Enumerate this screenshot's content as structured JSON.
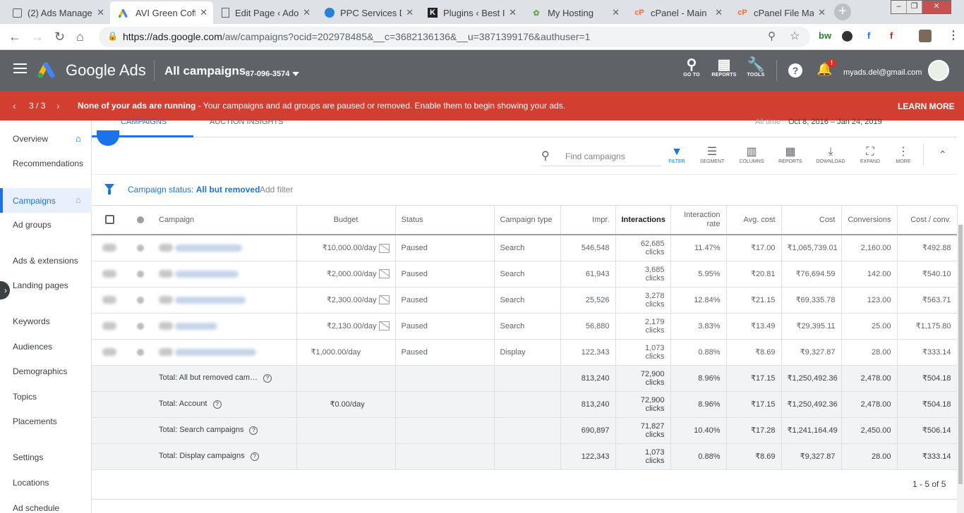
{
  "browser": {
    "tabs": [
      {
        "title": "(2) Ads Manage",
        "favicon": "fb-ads"
      },
      {
        "title": "AVI Green Coffe",
        "favicon": "google-ads"
      },
      {
        "title": "Edit Page ‹ Ado",
        "favicon": "page"
      },
      {
        "title": "PPC Services Dr",
        "favicon": "ppc"
      },
      {
        "title": "Plugins ‹ Best In",
        "favicon": "k"
      },
      {
        "title": "My Hosting",
        "favicon": "hosting"
      },
      {
        "title": "cPanel - Main",
        "favicon": "cpanel"
      },
      {
        "title": "cPanel File Mar",
        "favicon": "cpanel"
      }
    ],
    "url_host": "https://ads.google.com",
    "url_path": "/aw/campaigns?ocid=202978485&__c=3682136136&__u=3871399176&authuser=1",
    "extensions": [
      "bw",
      "f",
      "f"
    ]
  },
  "header": {
    "product_google": "Google",
    "product_ads": "Ads",
    "page_title": "All campaigns",
    "account_id": "87-096-3574",
    "icons": [
      {
        "label": "GO TO",
        "name": "search-icon"
      },
      {
        "label": "REPORTS",
        "name": "reports-icon"
      },
      {
        "label": "TOOLS",
        "name": "tools-icon"
      }
    ],
    "notification_badge": "!",
    "email": "myads.del@gmail.com"
  },
  "banner": {
    "page": "3 / 3",
    "message_bold": "None of your ads are running",
    "message_rest": " - Your campaigns and ad groups are paused or removed. Enable them to begin showing your ads.",
    "action": "LEARN MORE",
    "color": "#d23f31"
  },
  "sidebar": {
    "items": [
      {
        "label": "Overview"
      },
      {
        "label": "Recommendations"
      },
      {
        "label": "Campaigns"
      },
      {
        "label": "Ad groups"
      },
      {
        "label": "Ads & extensions"
      },
      {
        "label": "Landing pages"
      },
      {
        "label": "Keywords"
      },
      {
        "label": "Audiences"
      },
      {
        "label": "Demographics"
      },
      {
        "label": "Topics"
      },
      {
        "label": "Placements"
      },
      {
        "label": "Settings"
      },
      {
        "label": "Locations"
      },
      {
        "label": "Ad schedule"
      }
    ]
  },
  "subtabs": {
    "campaigns": "CAMPAIGNS",
    "auction": "AUCTION INSIGHTS",
    "all_time": "All time",
    "date_range": "Oct 8, 2016 – Jan 24, 2019"
  },
  "toolbar": {
    "search_placeholder": "Find campaigns",
    "buttons": [
      "FILTER",
      "SEGMENT",
      "COLUMNS",
      "REPORTS",
      "DOWNLOAD",
      "EXPAND",
      "MORE"
    ]
  },
  "filter": {
    "label": "Campaign status: ",
    "value": "All but removed",
    "add": "Add filter"
  },
  "table": {
    "headers": {
      "campaign": "Campaign",
      "budget": "Budget",
      "status": "Status",
      "type": "Campaign type",
      "impr": "Impr.",
      "interactions": "Interactions",
      "interaction_rate": "Interaction rate",
      "avg_cost": "Avg. cost",
      "cost": "Cost",
      "conversions": "Conversions",
      "cost_conv": "Cost / conv."
    },
    "rows": [
      {
        "budget": "₹10,000.00/day",
        "status": "Paused",
        "type": "Search",
        "impr": "546,548",
        "interactions": "62,685",
        "unit": "clicks",
        "rate": "11.47%",
        "avg": "₹17.00",
        "cost": "₹1,065,739.01",
        "conv": "2,160.00",
        "cpc": "₹492.88"
      },
      {
        "budget": "₹2,000.00/day",
        "status": "Paused",
        "type": "Search",
        "impr": "61,943",
        "interactions": "3,685",
        "unit": "clicks",
        "rate": "5.95%",
        "avg": "₹20.81",
        "cost": "₹76,694.59",
        "conv": "142.00",
        "cpc": "₹540.10"
      },
      {
        "budget": "₹2,300.00/day",
        "status": "Paused",
        "type": "Search",
        "impr": "25,526",
        "interactions": "3,278",
        "unit": "clicks",
        "rate": "12.84%",
        "avg": "₹21.15",
        "cost": "₹69,335.78",
        "conv": "123.00",
        "cpc": "₹563.71"
      },
      {
        "budget": "₹2,130.00/day",
        "status": "Paused",
        "type": "Search",
        "impr": "56,880",
        "interactions": "2,179",
        "unit": "clicks",
        "rate": "3.83%",
        "avg": "₹13.49",
        "cost": "₹29,395.11",
        "conv": "25.00",
        "cpc": "₹1,175.80"
      },
      {
        "budget": "₹1,000.00/day",
        "status": "Paused",
        "type": "Display",
        "impr": "122,343",
        "interactions": "1,073",
        "unit": "clicks",
        "rate": "0.88%",
        "avg": "₹8.69",
        "cost": "₹9,327.87",
        "conv": "28.00",
        "cpc": "₹333.14"
      }
    ],
    "totals": [
      {
        "label": "Total: All but removed cam…",
        "budget": "",
        "impr": "813,240",
        "interactions": "72,900",
        "unit": "clicks",
        "rate": "8.96%",
        "avg": "₹17.15",
        "cost": "₹1,250,492.36",
        "conv": "2,478.00",
        "cpc": "₹504.18"
      },
      {
        "label": "Total: Account",
        "budget": "₹0.00/day",
        "impr": "813,240",
        "interactions": "72,900",
        "unit": "clicks",
        "rate": "8.96%",
        "avg": "₹17.15",
        "cost": "₹1,250,492.36",
        "conv": "2,478.00",
        "cpc": "₹504.18"
      },
      {
        "label": "Total: Search campaigns",
        "budget": "",
        "impr": "690,897",
        "interactions": "71,827",
        "unit": "clicks",
        "rate": "10.40%",
        "avg": "₹17.28",
        "cost": "₹1,241,164.49",
        "conv": "2,450.00",
        "cpc": "₹506.14"
      },
      {
        "label": "Total: Display campaigns",
        "budget": "",
        "impr": "122,343",
        "interactions": "1,073",
        "unit": "clicks",
        "rate": "0.88%",
        "avg": "₹8.69",
        "cost": "₹9,327.87",
        "conv": "28.00",
        "cpc": "₹333.14"
      }
    ],
    "pager": "1 - 5 of 5"
  },
  "colors": {
    "accent": "#1a73e8",
    "header": "#5f6368",
    "banner": "#d23f31"
  }
}
